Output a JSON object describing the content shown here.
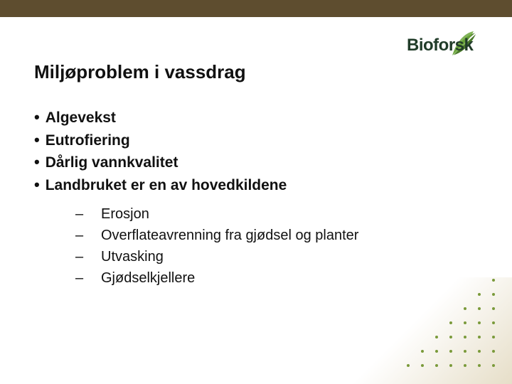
{
  "brand": {
    "name": "Bioforsk"
  },
  "slide": {
    "title": "Miljøproblem i vassdrag",
    "bullets": [
      "Algevekst",
      "Eutrofiering",
      "Dårlig vannkvalitet",
      "Landbruket er en av hovedkildene"
    ],
    "sub_bullets": [
      "Erosjon",
      "Overflateavrenning fra gjødsel og planter",
      "Utvasking",
      "Gjødselkjellere"
    ]
  }
}
